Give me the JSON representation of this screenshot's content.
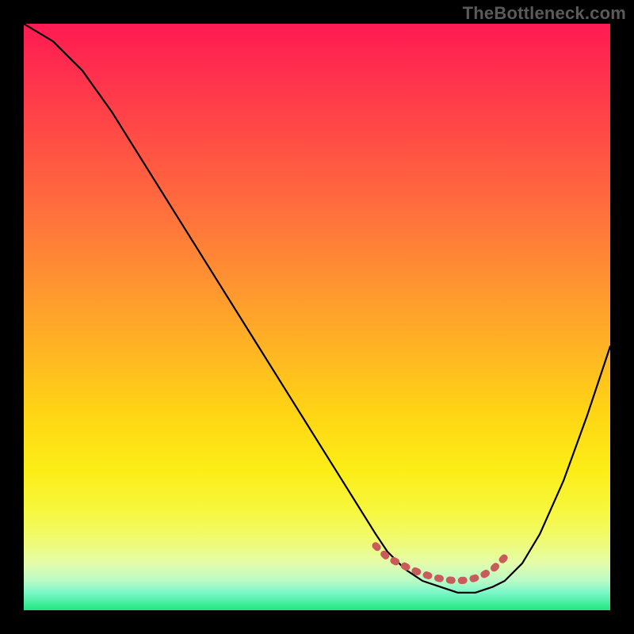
{
  "watermark": "TheBottleneck.com",
  "chart_data": {
    "type": "line",
    "title": "",
    "xlabel": "",
    "ylabel": "",
    "xlim": [
      0,
      100
    ],
    "ylim": [
      0,
      100
    ],
    "series": [
      {
        "name": "curve",
        "x": [
          0,
          5,
          10,
          15,
          20,
          25,
          30,
          35,
          40,
          45,
          50,
          55,
          60,
          62,
          65,
          68,
          71,
          74,
          77,
          80,
          82,
          85,
          88,
          92,
          96,
          100
        ],
        "values": [
          100,
          97,
          92,
          85,
          77,
          69,
          61,
          53,
          45,
          37,
          29,
          21,
          13,
          10,
          7,
          5,
          4,
          3,
          3,
          4,
          5,
          8,
          13,
          22,
          33,
          45
        ]
      },
      {
        "name": "marker-band",
        "x": [
          60,
          62,
          64,
          66,
          68,
          70,
          72,
          74,
          76,
          78,
          80,
          82
        ],
        "values": [
          11,
          9,
          8,
          7,
          6.2,
          5.6,
          5.2,
          5,
          5.2,
          5.8,
          7,
          9
        ]
      }
    ],
    "gradient_stops": [
      {
        "pos": 0.0,
        "color": "#ff1a52"
      },
      {
        "pos": 0.18,
        "color": "#ff4946"
      },
      {
        "pos": 0.42,
        "color": "#ff8d33"
      },
      {
        "pos": 0.66,
        "color": "#ffd415"
      },
      {
        "pos": 0.83,
        "color": "#f7f73e"
      },
      {
        "pos": 0.95,
        "color": "#b8fbc6"
      },
      {
        "pos": 1.0,
        "color": "#21e77f"
      }
    ],
    "marker_color": "#c95b5b"
  }
}
